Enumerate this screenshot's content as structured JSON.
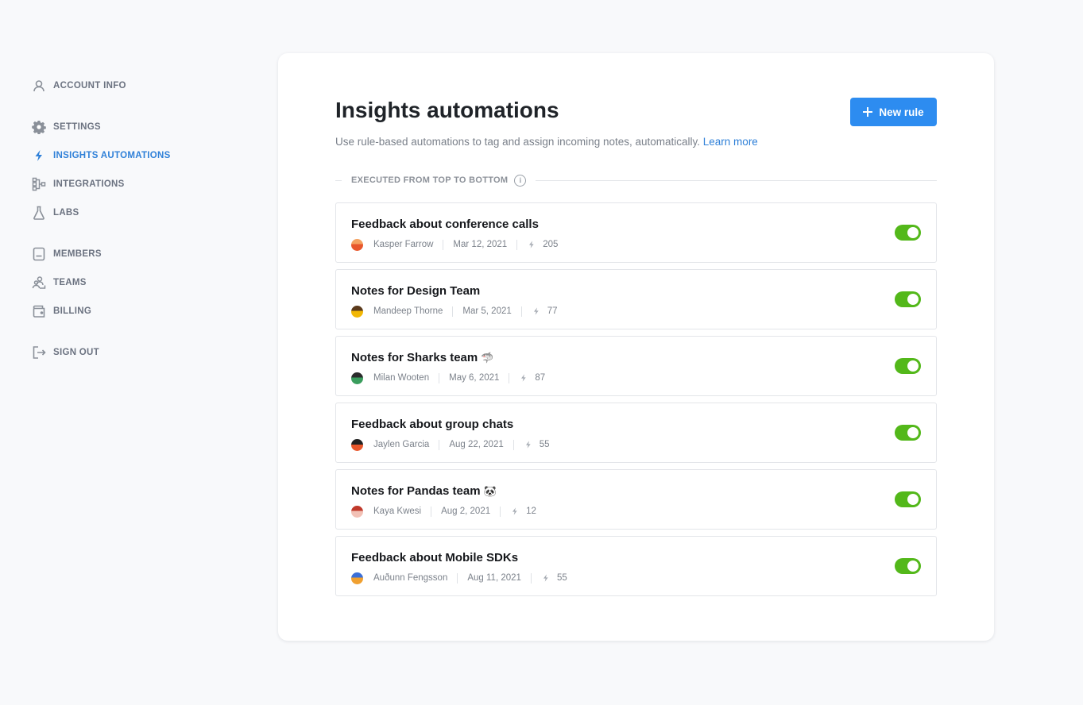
{
  "sidebar": {
    "groups": [
      [
        {
          "label": "ACCOUNT INFO",
          "icon": "user-icon"
        }
      ],
      [
        {
          "label": "SETTINGS",
          "icon": "gear-icon"
        },
        {
          "label": "INSIGHTS AUTOMATIONS",
          "icon": "bolt-icon",
          "active": true
        },
        {
          "label": "INTEGRATIONS",
          "icon": "integrations-icon"
        },
        {
          "label": "LABS",
          "icon": "flask-icon"
        }
      ],
      [
        {
          "label": "MEMBERS",
          "icon": "members-icon"
        },
        {
          "label": "TEAMS",
          "icon": "teams-icon"
        },
        {
          "label": "BILLING",
          "icon": "wallet-icon"
        }
      ],
      [
        {
          "label": "SIGN OUT",
          "icon": "sign-out-icon"
        }
      ]
    ]
  },
  "main": {
    "title": "Insights automations",
    "subtitle": "Use rule-based automations to tag and assign incoming notes, automatically.",
    "learn_more": "Learn more",
    "new_rule_label": "New rule",
    "section_label": "EXECUTED FROM TOP TO BOTTOM",
    "info_glyph": "i"
  },
  "colors": {
    "accent": "#2d8cf0",
    "active_nav": "#2f80d8",
    "toggle_on": "#53b81a"
  },
  "rules": [
    {
      "title": "Feedback about conference calls",
      "emoji": "",
      "author": "Kasper Farrow",
      "date": "Mar 12, 2021",
      "count": "205",
      "enabled": true,
      "avatar_colors": [
        "#e8572c",
        "#f4a261"
      ]
    },
    {
      "title": "Notes for Design Team",
      "emoji": "",
      "author": "Mandeep Thorne",
      "date": "Mar 5, 2021",
      "count": "77",
      "enabled": true,
      "avatar_colors": [
        "#f2b705",
        "#5b3a1c"
      ]
    },
    {
      "title": "Notes for Sharks team",
      "emoji": "🦈",
      "author": "Milan Wooten",
      "date": "May 6, 2021",
      "count": "87",
      "enabled": true,
      "avatar_colors": [
        "#3a9d5d",
        "#2b2b2b"
      ]
    },
    {
      "title": "Feedback about group chats",
      "emoji": "",
      "author": "Jaylen Garcia",
      "date": "Aug 22, 2021",
      "count": "55",
      "enabled": true,
      "avatar_colors": [
        "#e8572c",
        "#222222"
      ]
    },
    {
      "title": "Notes for Pandas team",
      "emoji": "🐼",
      "author": "Kaya Kwesi",
      "date": "Aug 2, 2021",
      "count": "12",
      "enabled": true,
      "avatar_colors": [
        "#f2c1b6",
        "#c0392b"
      ]
    },
    {
      "title": "Feedback about Mobile SDKs",
      "emoji": "",
      "author": "Auðunn Fengsson",
      "date": "Aug 11, 2021",
      "count": "55",
      "enabled": true,
      "avatar_colors": [
        "#f0a030",
        "#3a6fd8"
      ]
    }
  ]
}
